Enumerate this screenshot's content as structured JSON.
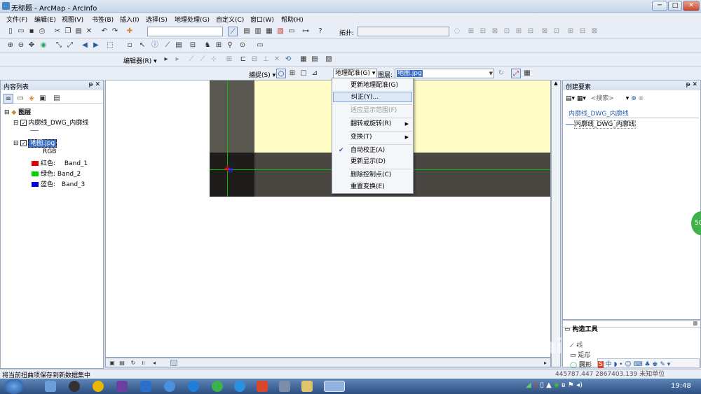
{
  "window": {
    "title": "无标题 - ArcMap - ArcInfo",
    "min": "─",
    "max": "□",
    "close": "✕"
  },
  "menubar": [
    "文件(F)",
    "编辑(E)",
    "视图(V)",
    "书签(B)",
    "插入(I)",
    "选择(S)",
    "地理处理(G)",
    "自定义(C)",
    "窗口(W)",
    "帮助(H)"
  ],
  "toolbar1": {
    "topology_label": "拓扑:",
    "scale_value": "",
    "topology_value": ""
  },
  "toolbar3": {
    "editor_label": "编辑器(R) ▾"
  },
  "toolbar4": {
    "snap_label": "捕捉(S) ▾",
    "georef_label": "地理配准(G) ▾",
    "layer_label": "图层:",
    "layer_value": "地图.jpg"
  },
  "toc": {
    "title": "内容列表",
    "layers_root": "图层",
    "layer1": "内廓线_DWG_内廓线",
    "layer2": "地图.jpg",
    "rgb": "RGB",
    "bands": [
      {
        "label": "红色:",
        "band": "Band_1",
        "color": "#e00000"
      },
      {
        "label": "绿色:",
        "band": "Band_2",
        "color": "#00d200"
      },
      {
        "label": "蓝色:",
        "band": "Band_3",
        "color": "#0000e0"
      }
    ]
  },
  "context_menu": {
    "items": [
      {
        "label": "更新地理配准(G)",
        "state": "normal"
      },
      {
        "label": "纠正(Y)...",
        "state": "selected"
      },
      {
        "label": "适应显示范围(F)",
        "state": "disabled"
      },
      {
        "label": "翻转或旋转(R)",
        "state": "submenu"
      },
      {
        "label": "变换(T)",
        "state": "submenu"
      },
      {
        "label": "自动校正(A)",
        "state": "checked"
      },
      {
        "label": "更新显示(D)",
        "state": "normal"
      },
      {
        "label": "删除控制点(C)",
        "state": "normal"
      },
      {
        "label": "重置变换(E)",
        "state": "normal"
      }
    ]
  },
  "create_features": {
    "title": "创建要素",
    "search_placeholder": "<搜索>",
    "group": "内廓线_DWG_内廓线",
    "item": "内廓线_DWG_内廓线"
  },
  "construction_tools": {
    "title": "构造工具",
    "items": [
      "线",
      "矩形",
      "圆形"
    ]
  },
  "statusbar": {
    "message": "将当前扭曲项保存到新数据集中",
    "coords": "445787.447  2867403.139 未知单位"
  },
  "taskbar": {
    "time": "19:48"
  },
  "badge": "50",
  "watermark": "Bai 经验",
  "colors": {
    "accent": "#3a6fc4",
    "map_yellow": "#fffcc6",
    "map_dark": "#4a4743"
  }
}
